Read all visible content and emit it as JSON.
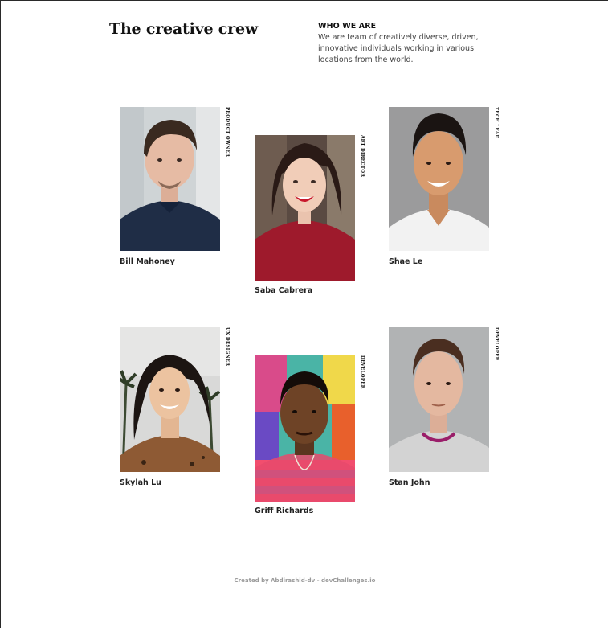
{
  "header": {
    "title": "The creative crew",
    "about_heading": "WHO WE ARE",
    "about_text": "We are team of creatively diverse, driven, innovative individuals working in various locations from the world."
  },
  "members": [
    {
      "name": "Bill Mahoney",
      "role": "PRODUCT OWNER",
      "photo_icon": "portrait-man-navy-shirt-icon"
    },
    {
      "name": "Saba Cabrera",
      "role": "ART DIRECTOR",
      "photo_icon": "portrait-woman-red-sweater-icon"
    },
    {
      "name": "Shae Le",
      "role": "TECH LEAD",
      "photo_icon": "portrait-man-white-tshirt-icon"
    },
    {
      "name": "Skylah Lu",
      "role": "UX DESIGNER",
      "photo_icon": "portrait-woman-palms-icon"
    },
    {
      "name": "Griff Richards",
      "role": "DEVELOPER",
      "photo_icon": "portrait-man-graffiti-icon"
    },
    {
      "name": "Stan John",
      "role": "DEVELOPER",
      "photo_icon": "portrait-man-grey-sweater-icon"
    }
  ],
  "footer": {
    "credit": "Created by Abdirashid-dv - devChallenges.io"
  },
  "colors": {
    "text_primary": "#111111",
    "text_secondary": "#444444",
    "footer_text": "#9a9a9a"
  }
}
